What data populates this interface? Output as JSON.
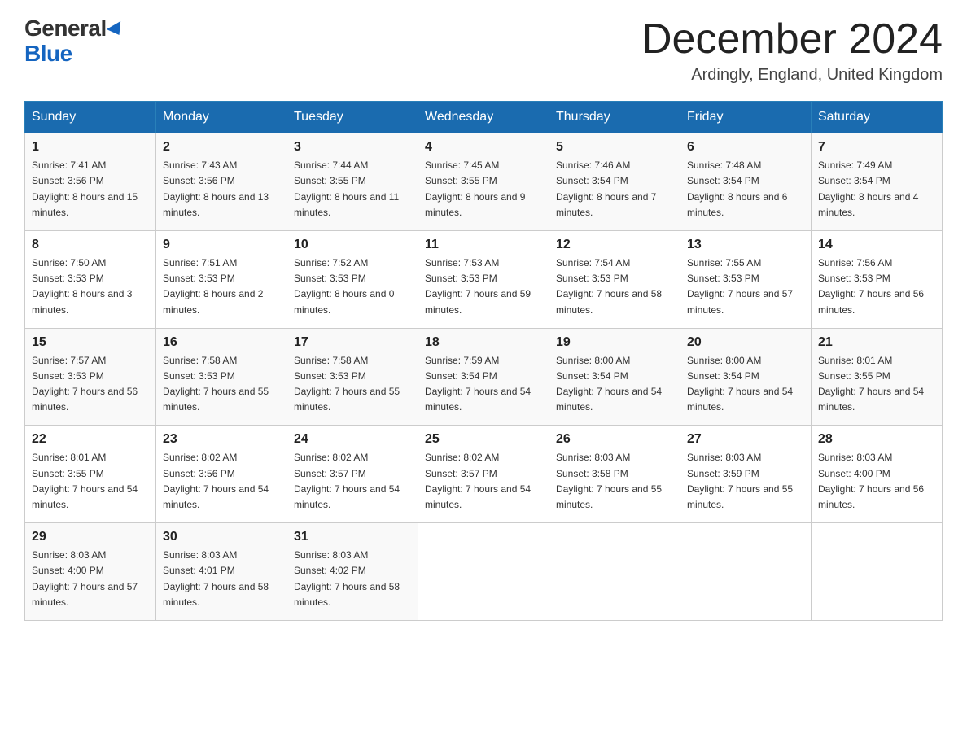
{
  "logo": {
    "general": "General",
    "blue": "Blue"
  },
  "title": "December 2024",
  "location": "Ardingly, England, United Kingdom",
  "headers": [
    "Sunday",
    "Monday",
    "Tuesday",
    "Wednesday",
    "Thursday",
    "Friday",
    "Saturday"
  ],
  "weeks": [
    [
      {
        "day": "1",
        "sunrise": "7:41 AM",
        "sunset": "3:56 PM",
        "daylight": "8 hours and 15 minutes."
      },
      {
        "day": "2",
        "sunrise": "7:43 AM",
        "sunset": "3:56 PM",
        "daylight": "8 hours and 13 minutes."
      },
      {
        "day": "3",
        "sunrise": "7:44 AM",
        "sunset": "3:55 PM",
        "daylight": "8 hours and 11 minutes."
      },
      {
        "day": "4",
        "sunrise": "7:45 AM",
        "sunset": "3:55 PM",
        "daylight": "8 hours and 9 minutes."
      },
      {
        "day": "5",
        "sunrise": "7:46 AM",
        "sunset": "3:54 PM",
        "daylight": "8 hours and 7 minutes."
      },
      {
        "day": "6",
        "sunrise": "7:48 AM",
        "sunset": "3:54 PM",
        "daylight": "8 hours and 6 minutes."
      },
      {
        "day": "7",
        "sunrise": "7:49 AM",
        "sunset": "3:54 PM",
        "daylight": "8 hours and 4 minutes."
      }
    ],
    [
      {
        "day": "8",
        "sunrise": "7:50 AM",
        "sunset": "3:53 PM",
        "daylight": "8 hours and 3 minutes."
      },
      {
        "day": "9",
        "sunrise": "7:51 AM",
        "sunset": "3:53 PM",
        "daylight": "8 hours and 2 minutes."
      },
      {
        "day": "10",
        "sunrise": "7:52 AM",
        "sunset": "3:53 PM",
        "daylight": "8 hours and 0 minutes."
      },
      {
        "day": "11",
        "sunrise": "7:53 AM",
        "sunset": "3:53 PM",
        "daylight": "7 hours and 59 minutes."
      },
      {
        "day": "12",
        "sunrise": "7:54 AM",
        "sunset": "3:53 PM",
        "daylight": "7 hours and 58 minutes."
      },
      {
        "day": "13",
        "sunrise": "7:55 AM",
        "sunset": "3:53 PM",
        "daylight": "7 hours and 57 minutes."
      },
      {
        "day": "14",
        "sunrise": "7:56 AM",
        "sunset": "3:53 PM",
        "daylight": "7 hours and 56 minutes."
      }
    ],
    [
      {
        "day": "15",
        "sunrise": "7:57 AM",
        "sunset": "3:53 PM",
        "daylight": "7 hours and 56 minutes."
      },
      {
        "day": "16",
        "sunrise": "7:58 AM",
        "sunset": "3:53 PM",
        "daylight": "7 hours and 55 minutes."
      },
      {
        "day": "17",
        "sunrise": "7:58 AM",
        "sunset": "3:53 PM",
        "daylight": "7 hours and 55 minutes."
      },
      {
        "day": "18",
        "sunrise": "7:59 AM",
        "sunset": "3:54 PM",
        "daylight": "7 hours and 54 minutes."
      },
      {
        "day": "19",
        "sunrise": "8:00 AM",
        "sunset": "3:54 PM",
        "daylight": "7 hours and 54 minutes."
      },
      {
        "day": "20",
        "sunrise": "8:00 AM",
        "sunset": "3:54 PM",
        "daylight": "7 hours and 54 minutes."
      },
      {
        "day": "21",
        "sunrise": "8:01 AM",
        "sunset": "3:55 PM",
        "daylight": "7 hours and 54 minutes."
      }
    ],
    [
      {
        "day": "22",
        "sunrise": "8:01 AM",
        "sunset": "3:55 PM",
        "daylight": "7 hours and 54 minutes."
      },
      {
        "day": "23",
        "sunrise": "8:02 AM",
        "sunset": "3:56 PM",
        "daylight": "7 hours and 54 minutes."
      },
      {
        "day": "24",
        "sunrise": "8:02 AM",
        "sunset": "3:57 PM",
        "daylight": "7 hours and 54 minutes."
      },
      {
        "day": "25",
        "sunrise": "8:02 AM",
        "sunset": "3:57 PM",
        "daylight": "7 hours and 54 minutes."
      },
      {
        "day": "26",
        "sunrise": "8:03 AM",
        "sunset": "3:58 PM",
        "daylight": "7 hours and 55 minutes."
      },
      {
        "day": "27",
        "sunrise": "8:03 AM",
        "sunset": "3:59 PM",
        "daylight": "7 hours and 55 minutes."
      },
      {
        "day": "28",
        "sunrise": "8:03 AM",
        "sunset": "4:00 PM",
        "daylight": "7 hours and 56 minutes."
      }
    ],
    [
      {
        "day": "29",
        "sunrise": "8:03 AM",
        "sunset": "4:00 PM",
        "daylight": "7 hours and 57 minutes."
      },
      {
        "day": "30",
        "sunrise": "8:03 AM",
        "sunset": "4:01 PM",
        "daylight": "7 hours and 58 minutes."
      },
      {
        "day": "31",
        "sunrise": "8:03 AM",
        "sunset": "4:02 PM",
        "daylight": "7 hours and 58 minutes."
      },
      null,
      null,
      null,
      null
    ]
  ],
  "labels": {
    "sunrise": "Sunrise:",
    "sunset": "Sunset:",
    "daylight": "Daylight:"
  }
}
